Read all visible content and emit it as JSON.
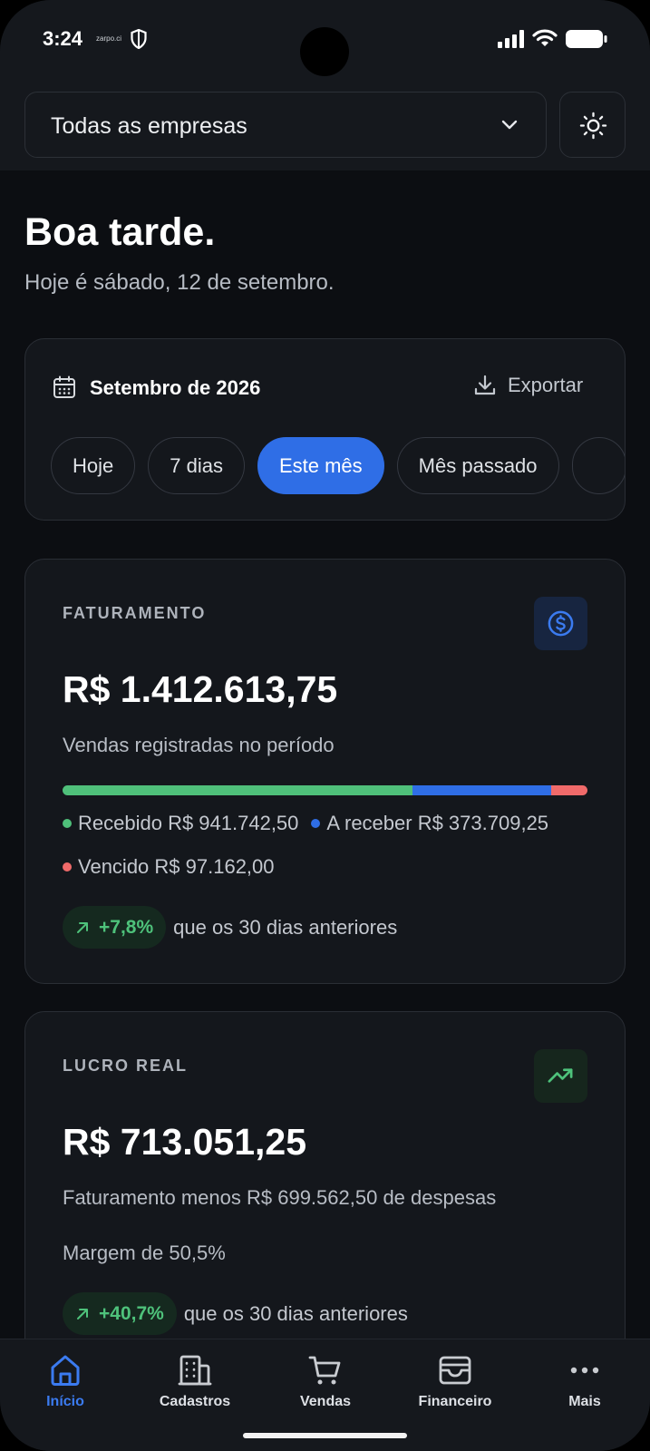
{
  "status_bar": {
    "time": "3:24",
    "mini_text": "zarpo.ci"
  },
  "header": {
    "company_select": "Todas as empresas"
  },
  "greeting": {
    "title": "Boa tarde.",
    "subtitle": "Hoje é sábado, 12 de setembro."
  },
  "period": {
    "title": "Setembro de 2026",
    "export_label": "Exportar",
    "chips": [
      {
        "label": "Hoje",
        "active": false
      },
      {
        "label": "7 dias",
        "active": false
      },
      {
        "label": "Este mês",
        "active": true
      },
      {
        "label": "Mês passado",
        "active": false
      }
    ]
  },
  "faturamento": {
    "label": "FATURAMENTO",
    "value": "R$ 1.412.613,75",
    "description": "Vendas registradas no período",
    "breakdown": {
      "recebido_label": "Recebido R$ 941.742,50",
      "a_receber_label": "A receber R$ 373.709,25",
      "vencido_label": "Vencido R$ 97.162,00",
      "recebido_value": 941742.5,
      "a_receber_value": 373709.25,
      "vencido_value": 97162.0,
      "colors": {
        "recebido": "#4fc07a",
        "a_receber": "#2f6ee6",
        "vencido": "#f06a6a"
      }
    },
    "trend_value": "+7,8%",
    "trend_text": "que os 30 dias anteriores"
  },
  "lucro": {
    "label": "LUCRO REAL",
    "value": "R$ 713.051,25",
    "description": "Faturamento menos R$ 699.562,50 de despesas",
    "margin": "Margem de 50,5%",
    "trend_value": "+40,7%",
    "trend_text": "que os 30 dias anteriores"
  },
  "nav": {
    "items": [
      {
        "label": "Início",
        "icon": "home-icon",
        "active": true
      },
      {
        "label": "Cadastros",
        "icon": "building-icon",
        "active": false
      },
      {
        "label": "Vendas",
        "icon": "cart-icon",
        "active": false
      },
      {
        "label": "Financeiro",
        "icon": "wallet-icon",
        "active": false
      },
      {
        "label": "Mais",
        "icon": "more-icon",
        "active": false
      }
    ]
  },
  "colors": {
    "accent": "#2f6ee6",
    "positive": "#4ec27b",
    "background": "#0c0e12",
    "card": "#14171c"
  }
}
